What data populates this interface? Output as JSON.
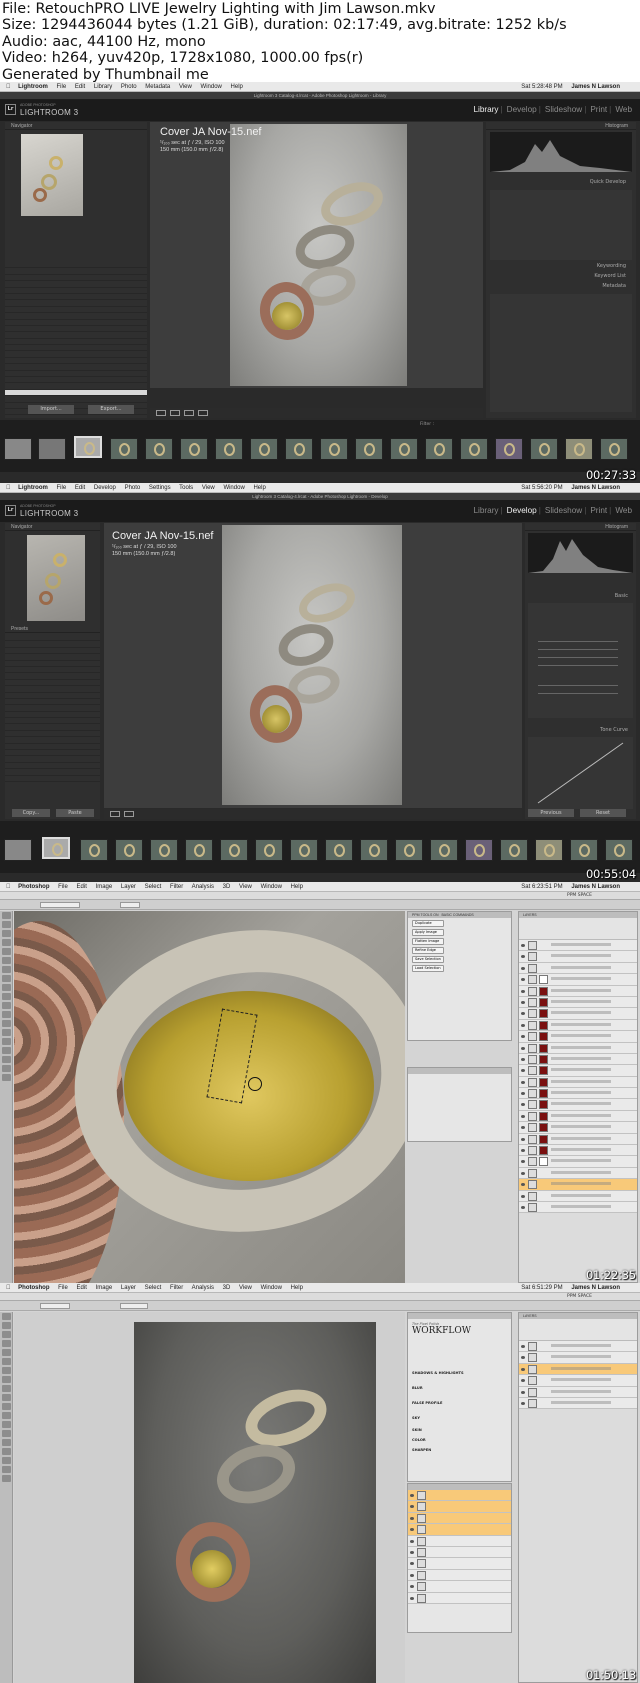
{
  "header": {
    "lines": [
      "File: RetouchPRO LIVE Jewelry Lighting with Jim Lawson.mkv",
      "Size: 1294436044 bytes (1.21 GiB), duration: 02:17:49, avg.bitrate: 1252 kb/s",
      "Audio: aac, 44100 Hz, mono",
      "Video: h264, yuv420p, 1728x1080, 1000.00 fps(r)",
      "Generated by Thumbnail me"
    ]
  },
  "frames": [
    {
      "app": "Lightroom",
      "mac_menu": [
        "Lightroom",
        "File",
        "Edit",
        "Library",
        "Photo",
        "Metadata",
        "View",
        "Window",
        "Help"
      ],
      "clock": "Sat 5:28:48 PM",
      "user": "James N Lawson",
      "window_title": "Lightroom 3 Catalog-4.lrcat - Adobe Photoshop Lightroom - Library",
      "brand_small": "ADOBE PHOTOSHOP",
      "brand": "LIGHTROOM 3",
      "modules": [
        "Library",
        "Develop",
        "Slideshow",
        "Print",
        "Web"
      ],
      "active_module": "Library",
      "left_panel_title": "Navigator",
      "right_panel_title": "Histogram",
      "right_sections": [
        "Quick Develop",
        "Keywording",
        "Keyword List",
        "Metadata"
      ],
      "buttons": [
        "Import...",
        "Export..."
      ],
      "photo_title": "Cover JA Nov-15.nef",
      "photo_sub1": "¹/₁₀₀ sec at ƒ / 29, ISO 100",
      "photo_sub2": "150 mm (150.0 mm ƒ/2.8)",
      "filter_label": "Filter :",
      "timecode": "00:27:33"
    },
    {
      "app": "Lightroom",
      "mac_menu": [
        "Lightroom",
        "File",
        "Edit",
        "Develop",
        "Photo",
        "Settings",
        "Tools",
        "View",
        "Window",
        "Help"
      ],
      "clock": "Sat 5:56:20 PM",
      "user": "James N Lawson",
      "window_title": "Lightroom 3 Catalog-4.lrcat - Adobe Photoshop Lightroom - Develop",
      "brand_small": "ADOBE PHOTOSHOP",
      "brand": "LIGHTROOM 3",
      "modules": [
        "Library",
        "Develop",
        "Slideshow",
        "Print",
        "Web"
      ],
      "active_module": "Develop",
      "left_panel_title": "Navigator",
      "left_section": "Presets",
      "right_panel_title": "Histogram",
      "right_sections": [
        "Basic",
        "Tone Curve"
      ],
      "buttons": [
        "Copy...",
        "Paste"
      ],
      "right_buttons": [
        "Previous",
        "Reset"
      ],
      "photo_title": "Cover JA Nov-15.nef",
      "photo_sub1": "¹/₁₀₀ sec at ƒ / 29, ISO 100",
      "photo_sub2": "150 mm (150.0 mm ƒ/2.8)",
      "timecode": "00:55:04"
    },
    {
      "app": "Photoshop",
      "mac_menu": [
        "Photoshop",
        "File",
        "Edit",
        "Image",
        "Layer",
        "Select",
        "Filter",
        "Analysis",
        "3D",
        "View",
        "Window",
        "Help"
      ],
      "clock": "Sat 6:23:51 PM",
      "user": "James N Lawson",
      "workspace": "PPM SPACE",
      "panel_tabs": [
        "PPM TOOLS ON",
        "BASIC COMMANDS"
      ],
      "panel_buttons": [
        "Duplicate",
        "Apply Image",
        "Flatten Image",
        "Refine Edge",
        "Save Selection",
        "Load Selection"
      ],
      "layers_tab": "LAYERS",
      "timecode": "01:22:35"
    },
    {
      "app": "Photoshop",
      "mac_menu": [
        "Photoshop",
        "File",
        "Edit",
        "Image",
        "Layer",
        "Select",
        "Filter",
        "Analysis",
        "3D",
        "View",
        "Window",
        "Help"
      ],
      "clock": "Sat 6:51:29 PM",
      "user": "James N Lawson",
      "workspace": "PPM SPACE",
      "panel_brand_small": "The Pixel Polish",
      "panel_brand": "WORKFLOW",
      "panel_labels": [
        "SHADOWS & HIGHLIGHTS",
        "BLUR",
        "FALSE PROFILE",
        "SKY",
        "SKIN",
        "COLOR",
        "SHARPEN"
      ],
      "layers_tab": "LAYERS",
      "timecode": "01:50:13"
    }
  ]
}
